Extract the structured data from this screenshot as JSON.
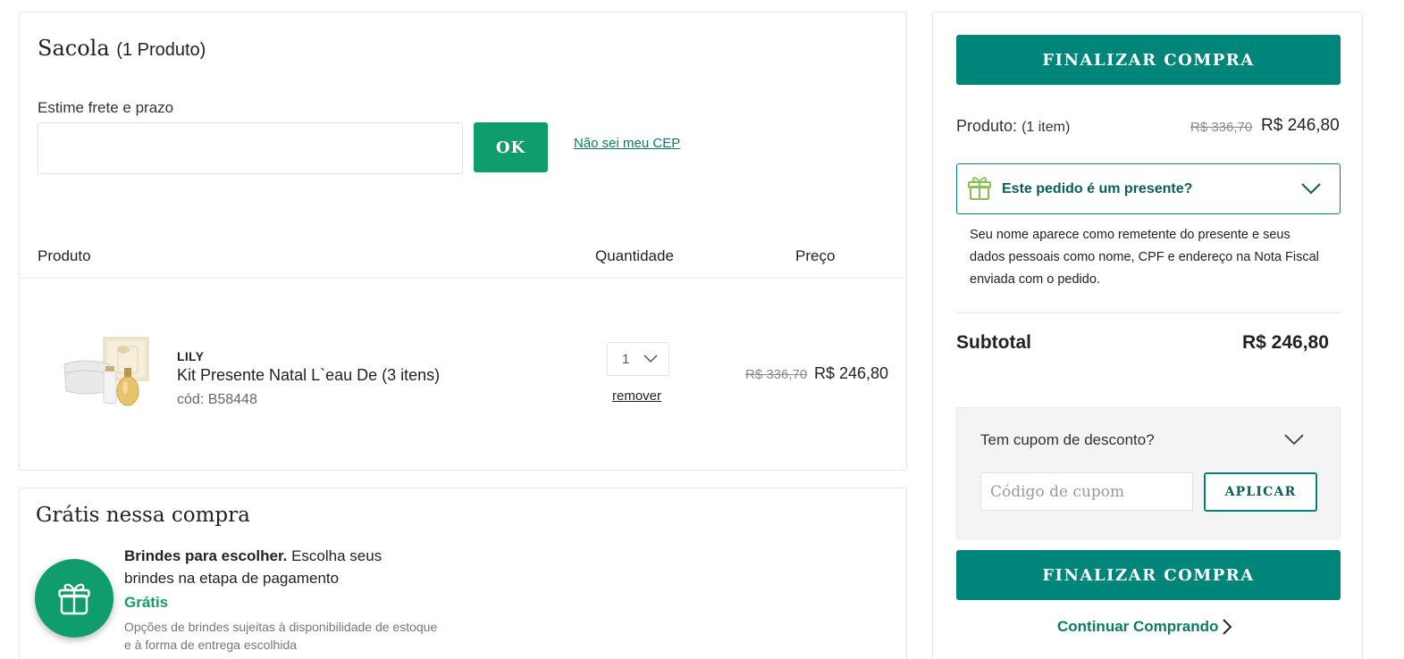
{
  "bag": {
    "title": "Sacola",
    "count": "(1 Produto)",
    "shipping_label": "Estime frete e prazo",
    "cep_placeholder": "",
    "ok_label": "OK",
    "cep_link": "Não sei meu CEP",
    "headers": {
      "product": "Produto",
      "quantity": "Quantidade",
      "price": "Preço"
    },
    "items": [
      {
        "brand": "LILY",
        "name": "Kit Presente Natal L`eau De (3 itens)",
        "code": "cód: B58448",
        "quantity": "1",
        "remove_label": "remover",
        "price_old": "R$ 336,70",
        "price_new": "R$ 246,80"
      }
    ]
  },
  "gifts": {
    "title": "Grátis nessa compra",
    "desc_bold": "Brindes para escolher.",
    "desc_rest": " Escolha seus brindes na etapa de pagamento",
    "free_label": "Grátis",
    "note": "Opções de brindes sujeitas à disponibilidade de estoque e à forma de entrega escolhida"
  },
  "summary": {
    "checkout_label": "FINALIZAR COMPRA",
    "product_label": "Produto:",
    "product_items": "(1 item)",
    "price_old": "R$ 336,70",
    "price_new": "R$ 246,80",
    "gift_question": "Este pedido é um presente?",
    "gift_info": "Seu nome aparece como remetente do presente e seus dados pessoais como nome, CPF e endereço na Nota Fiscal enviada com o pedido.",
    "subtotal_label": "Subtotal",
    "subtotal_value": "R$ 246,80",
    "coupon_question": "Tem cupom de desconto?",
    "coupon_placeholder": "Código de cupom",
    "apply_label": "APLICAR",
    "continue_label": "Continuar Comprando"
  },
  "colors": {
    "primary_teal": "#00857a",
    "accent_green": "#0f9d6b",
    "gift_icon": "#8cbf52"
  }
}
